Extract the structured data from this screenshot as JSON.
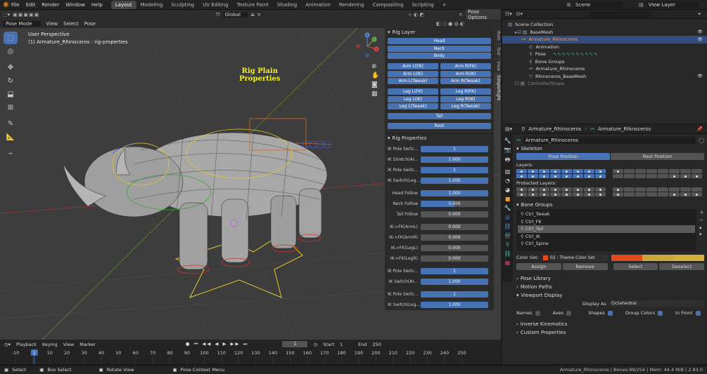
{
  "menu": [
    "File",
    "Edit",
    "Render",
    "Window",
    "Help"
  ],
  "workspaces": [
    "Layout",
    "Modeling",
    "Sculpting",
    "UV Editing",
    "Texture Paint",
    "Shading",
    "Animation",
    "Rendering",
    "Compositing",
    "Scripting"
  ],
  "workspace_add": "+",
  "scene": {
    "label": "Scene",
    "view_layer": "View Layer"
  },
  "viewport": {
    "mode": "Pose Mode",
    "menus": [
      "View",
      "Select",
      "Pose"
    ],
    "orientation": "Global",
    "pose_options": "Pose Options",
    "info_line1": "User Perspective",
    "info_line2": "(1) Armature_Rhinoceros : rig-properties",
    "rig_title_1": "Rig Plain",
    "rig_title_2": "Properties",
    "gizmo": {
      "x": "X",
      "y": "Y",
      "z": "Z"
    }
  },
  "side_tabs": [
    "Item",
    "Tool",
    "View",
    "SimpleRight"
  ],
  "rig_layer": {
    "title": "Rig Layer",
    "single": [
      "Head",
      "Neck",
      "Body"
    ],
    "pairs1": [
      [
        "Arm L(FK)",
        "Arm R(FK)"
      ],
      [
        "Arm L(IK)",
        "Arm R(IK)"
      ],
      [
        "Arm L(Tweak)",
        "Arm R(Tweak)"
      ]
    ],
    "pairs2": [
      [
        "Leg L(FK)",
        "Leg R(FK)"
      ],
      [
        "Leg L(IK)",
        "Leg R(IK)"
      ],
      [
        "Leg L(Tweak)",
        "Leg R(Tweak)"
      ]
    ],
    "tail": "Tail",
    "root": "Root"
  },
  "rig_props": {
    "title": "Rig Properties",
    "rows": [
      {
        "label": "IK Pole Switc...",
        "value": "1",
        "fill": 1.0
      },
      {
        "label": "IK Stretch(Ar...",
        "value": "1.000",
        "fill": 1.0
      },
      {
        "label": "IK Pole Switc...",
        "value": "1",
        "fill": 1.0
      },
      {
        "label": "IK Switch(Leg...",
        "value": "1.000",
        "fill": 1.0
      },
      {
        "label": "Head Follow",
        "value": "1.000",
        "fill": 1.0
      },
      {
        "label": "Neck Follow",
        "value": "0.500",
        "fill": 0.5
      },
      {
        "label": "Tail Follow",
        "value": "0.000",
        "fill": 0
      },
      {
        "label": "IK->FK(ArmL)",
        "value": "0.000",
        "fill": 0
      },
      {
        "label": "IK->FK(ArmR)",
        "value": "0.000",
        "fill": 0
      },
      {
        "label": "IK->FK(LegL)",
        "value": "0.000",
        "fill": 0
      },
      {
        "label": "IK->FK(LegR)",
        "value": "0.000",
        "fill": 0
      },
      {
        "label": "IK Pole Switc...",
        "value": "1",
        "fill": 1.0
      },
      {
        "label": "IK Switch(Ar...",
        "value": "1.000",
        "fill": 1.0
      },
      {
        "label": "IK Pole Switc...",
        "value": "1",
        "fill": 1.0
      },
      {
        "label": "IK Switch(Leg...",
        "value": "1.000",
        "fill": 1.0
      }
    ]
  },
  "outliner": {
    "rows": [
      {
        "label": "Scene Collection",
        "indent": 0
      },
      {
        "label": "BaseMesh",
        "indent": 1
      },
      {
        "label": "Armature_Rhinoceros",
        "indent": 2,
        "accent": true
      },
      {
        "label": "Animation",
        "indent": 3
      },
      {
        "label": "Pose",
        "indent": 3
      },
      {
        "label": "Bone Groups",
        "indent": 3
      },
      {
        "label": "Armature_Rhinoceros",
        "indent": 3
      },
      {
        "label": "Rhinoceros_BaseMesh",
        "indent": 3
      },
      {
        "label": "ControllerShape",
        "indent": 1,
        "dim": true
      }
    ]
  },
  "properties": {
    "breadcrumb": [
      "Armature_Rhinoceros",
      "Armature_Rhinoceros"
    ],
    "name": "Armature_Rhinoceros",
    "skeleton": "Skeleton",
    "pose_position": "Pose Position",
    "rest_position": "Rest Position",
    "layers": "Layers:",
    "protected_layers": "Protected Layers:",
    "bone_groups": "Bone Groups",
    "groups": [
      "Ctrl_Tweak",
      "Ctrl_FK",
      "Ctrl_Tail",
      "Ctrl_IK",
      "Ctrl_Spine"
    ],
    "selected_group": "Ctrl_Tail",
    "color_set_label": "Color Set:",
    "color_set": "02 - Theme Color Set",
    "assign": "Assign",
    "remove": "Remove",
    "select": "Select",
    "deselect": "Deselect",
    "pose_library": "Pose Library",
    "motion_paths": "Motion Paths",
    "viewport_display": "Viewport Display",
    "display_as_label": "Display As",
    "display_as": "Octahedral",
    "names": "Names",
    "axes": "Axes",
    "shapes": "Shapes",
    "group_colors": "Group Colors",
    "in_front": "In Front",
    "inverse_kinematics": "Inverse Kinematics",
    "custom_properties": "Custom Properties",
    "colors": [
      "#e04a1c",
      "#c9a83a",
      "#d2b23f"
    ]
  },
  "timeline": {
    "menus": [
      "Playback",
      "Keying",
      "View",
      "Marker"
    ],
    "current": "1",
    "start_label": "Start",
    "start": "1",
    "end_label": "End",
    "end": "250",
    "ticks": [
      "-10",
      "0",
      "10",
      "20",
      "30",
      "40",
      "50",
      "60",
      "70",
      "80",
      "90",
      "100",
      "110",
      "120",
      "130",
      "140",
      "150",
      "160",
      "170",
      "180",
      "190",
      "200",
      "210",
      "220",
      "230",
      "240",
      "250"
    ],
    "cursor": "1"
  },
  "status": {
    "select": "Select",
    "box_select": "Box Select",
    "rotate": "Rotate View",
    "context": "Pose Context Menu",
    "info": "Armature_Rhinoceros | Bones:99/254 | Mem: 44.4 MiB | 2.83.0"
  }
}
